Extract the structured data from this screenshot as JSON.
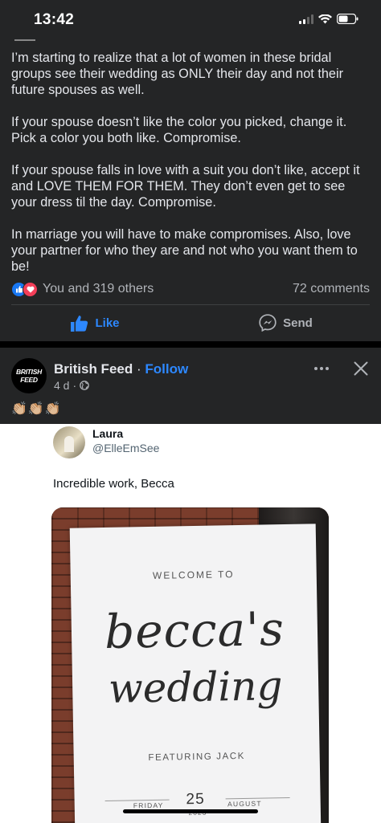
{
  "status_bar": {
    "time": "13:42",
    "icons": [
      "signal-icon",
      "wifi-icon",
      "battery-icon"
    ]
  },
  "post": {
    "paragraphs": [
      "I’m starting to realize that a lot of women in these bridal groups see their wedding as ONLY their day and not their future spouses as well.",
      "If your spouse doesn’t like the color you picked, change it. Pick a color you both like. Compromise.",
      "If your spouse falls in love with a suit you don’t like, accept it and LOVE THEM FOR THEM. They don’t even get to see your dress til the day. Compromise.",
      "In marriage you will have to make compromises. Also, love your partner for who they are and not who you want them to be!"
    ],
    "reactions_text": "You and 319 others",
    "comments_text": "72 comments",
    "actions": {
      "like": "Like",
      "send": "Send"
    }
  },
  "feed_post": {
    "page_name": "British Feed",
    "separator": " · ",
    "follow": "Follow",
    "time": "4 d",
    "meta_sep": "·",
    "avatar_text_top": "BRITISH",
    "avatar_text_bottom": "FEED",
    "emojis": "👏🏼👏🏼👏🏼"
  },
  "embedded_tweet": {
    "name": "Laura",
    "handle": "@ElleEmSee",
    "text": "Incredible work, Becca"
  },
  "sign": {
    "welcome": "WELCOME TO",
    "name_script": "becca's",
    "wedding_script": "wedding",
    "featuring": "FEATURING JACK",
    "day_label": "FRIDAY",
    "day_number": "25",
    "month": "AUGUST",
    "year": "2023"
  },
  "colors": {
    "card_bg": "#242526",
    "text_primary": "#e4e6eb",
    "text_secondary": "#b0b3b8",
    "accent_blue": "#2d88ff",
    "love_red": "#f33e58"
  }
}
